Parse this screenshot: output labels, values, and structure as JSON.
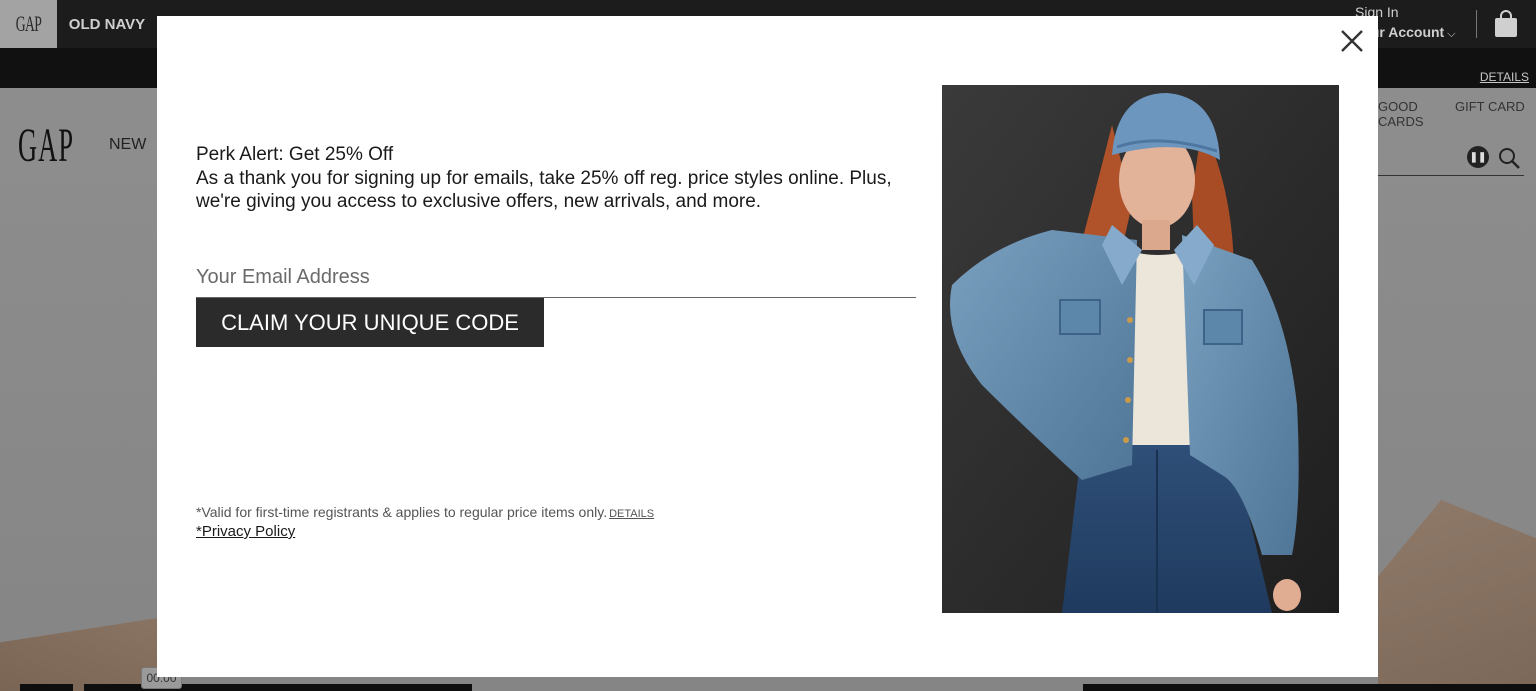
{
  "topbar": {
    "brands": [
      "GAP",
      "OLD NAVY"
    ],
    "sign_in": "Sign In",
    "account": "Your Account"
  },
  "promo": {
    "details": "DETAILS"
  },
  "nav": {
    "logo": "GAP",
    "new": "NEW",
    "goods_partial": "GOOD\nCARDS",
    "gift_card": "GIFT CARD"
  },
  "hero": {
    "video_time": "00:00"
  },
  "modal": {
    "title": "Perk Alert: Get 25% Off",
    "body": "As a thank you for signing up for emails, take 25% off reg. price styles online. Plus, we're giving you access to exclusive offers, new arrivals, and more.",
    "email_placeholder": "Your Email Address",
    "cta": "CLAIM YOUR UNIQUE CODE",
    "fine_print": "*Valid for first-time registrants & applies to regular price items only.",
    "fine_details": "DETAILS",
    "privacy": "*Privacy Policy"
  },
  "colors": {
    "dark": "#2b2b2b",
    "overlay": "#8a8a8a",
    "denim": "#5b85a8"
  }
}
